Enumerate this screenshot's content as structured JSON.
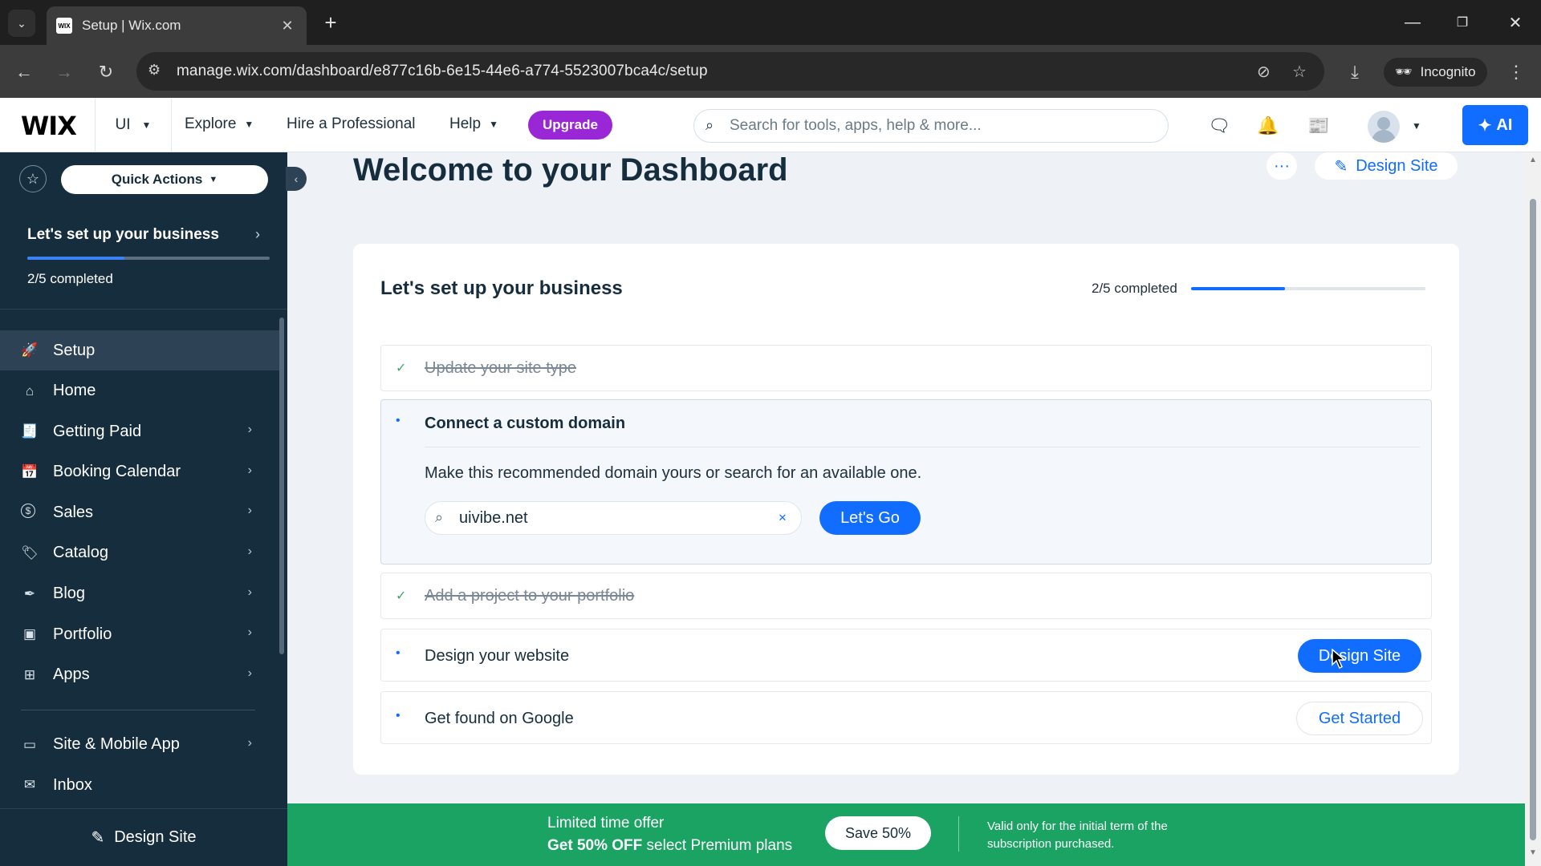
{
  "browser": {
    "tab_title": "Setup | Wix.com",
    "tab_favicon": "WIX",
    "url": "manage.wix.com/dashboard/e877c16b-6e15-44e6-a774-5523007bca4c/setup",
    "incognito_label": "Incognito"
  },
  "topbar": {
    "logo": "WIX",
    "site_name": "UI",
    "nav": [
      "Explore",
      "Hire a Professional",
      "Help"
    ],
    "upgrade_label": "Upgrade",
    "search_placeholder": "Search for tools, apps, help & more...",
    "ai_label": "AI"
  },
  "sidebar": {
    "quick_actions": "Quick Actions",
    "setup_title": "Let's set up your business",
    "setup_count": "2/5 completed",
    "setup_progress": 0.4,
    "items": [
      {
        "label": "Setup",
        "icon": "rocket-icon",
        "chevron": false,
        "active": true
      },
      {
        "label": "Home",
        "icon": "home-icon",
        "chevron": false,
        "active": false
      },
      {
        "label": "Getting Paid",
        "icon": "invoice-icon",
        "chevron": true,
        "active": false
      },
      {
        "label": "Booking Calendar",
        "icon": "calendar-icon",
        "chevron": true,
        "active": false
      },
      {
        "label": "Sales",
        "icon": "dollar-icon",
        "chevron": true,
        "active": false
      },
      {
        "label": "Catalog",
        "icon": "tag-icon",
        "chevron": true,
        "active": false
      },
      {
        "label": "Blog",
        "icon": "pen-icon",
        "chevron": true,
        "active": false
      },
      {
        "label": "Portfolio",
        "icon": "portfolio-icon",
        "chevron": true,
        "active": false
      },
      {
        "label": "Apps",
        "icon": "apps-icon",
        "chevron": true,
        "active": false
      }
    ],
    "items_bottom": [
      {
        "label": "Site & Mobile App",
        "icon": "mobile-icon",
        "chevron": true
      },
      {
        "label": "Inbox",
        "icon": "inbox-icon",
        "chevron": false
      }
    ],
    "design_site": "Design Site"
  },
  "main": {
    "title": "Welcome to your Dashboard",
    "design_site": "Design Site",
    "card": {
      "title": "Let's set up your business",
      "count": "2/5 completed",
      "progress": 0.4,
      "tasks": [
        {
          "label": "Update your site type",
          "done": true
        },
        {
          "label": "Connect a custom domain",
          "done": false,
          "expanded": true,
          "description": "Make this recommended domain yours or search for an available one.",
          "domain_value": "uivibe.net",
          "action": "Let's Go"
        },
        {
          "label": "Add a project to your portfolio",
          "done": true
        },
        {
          "label": "Design your website",
          "done": false,
          "action": "Design Site"
        },
        {
          "label": "Get found on Google",
          "done": false,
          "action": "Get Started"
        }
      ]
    }
  },
  "promo": {
    "title": "Limited time offer",
    "sub_bold": "Get 50% OFF",
    "sub_rest": " select Premium plans",
    "button": "Save 50%",
    "note": "Valid only for the initial term of the subscription purchased."
  },
  "colors": {
    "accent": "#116dff",
    "sidebar": "#162d3d",
    "upgrade": "#9a27d5",
    "promo": "#1aa363"
  }
}
